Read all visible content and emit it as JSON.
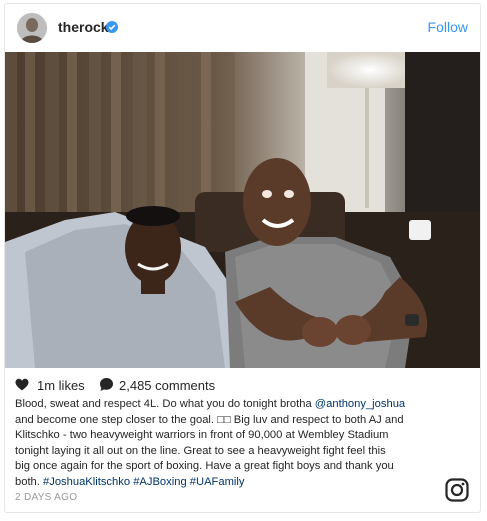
{
  "post": {
    "username": "therock",
    "follow_label": "Follow",
    "likes": "1m likes",
    "comments": "2,485 comments",
    "caption": {
      "line1_a": "Blood, sweat and respect 4L. Do what you do tonight brotha ",
      "line1_mention": "@anthony_joshua",
      "line2": "and become one step closer to the goal. □□ Big luv and respect to both AJ and",
      "line3": "Klitschko - two heavyweight warriors in front of 90,000 at Wembley Stadium",
      "line4": "tonight laying it all out on the line. Great to see a heavyweight fight feel this",
      "line5": "big once again for the sport of boxing. Have a great fight boys and thank you",
      "line6_a": "both. ",
      "hashtag1": "#JoshuaKlitschko",
      "hashtag2": "#AJBoxing",
      "hashtag3": "#UAFamily"
    },
    "date": "2 DAYS AGO"
  },
  "icons": {
    "verified": "verified-badge-icon",
    "heart": "heart-icon",
    "comment": "comment-bubble-icon",
    "instagram": "instagram-logo-icon"
  },
  "colors": {
    "link": "#003569",
    "follow": "#3897f0",
    "verified": "#3897f0",
    "muted": "#999999"
  }
}
